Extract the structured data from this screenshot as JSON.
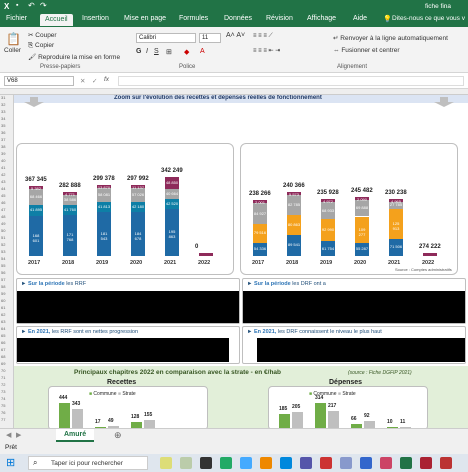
{
  "title_bar": {
    "app_label": "X",
    "doc_name": "fiche fina"
  },
  "tabs": [
    "Fichier",
    "Accueil",
    "Insertion",
    "Mise en page",
    "Formules",
    "Données",
    "Révision",
    "Affichage",
    "Aide"
  ],
  "tell_me": "Dites-nous ce que vous v",
  "clipboard": {
    "paste": "Coller",
    "cut": "Couper",
    "copy": "Copier",
    "format_painter": "Reproduire la mise en forme",
    "group": "Presse-papiers"
  },
  "font": {
    "name": "Calibri",
    "size": "11",
    "group": "Police"
  },
  "alignment": {
    "wrap": "Renvoyer à la ligne automatiquement",
    "merge": "Fusionner et centrer",
    "group": "Alignement"
  },
  "name_box": "V68",
  "fx": "fx",
  "banner": "Zoom sur l'évolution des recettes et dépenses réelles de fonctionnement",
  "rrf_chart": {
    "totals": [
      "367 345",
      "282 888",
      "299 378",
      "297 992",
      "342 249",
      "0"
    ],
    "years": [
      "2017",
      "2018",
      "2019",
      "2020",
      "2021",
      "2022"
    ],
    "bottom": [
      "168 601",
      "171 768",
      "181 543",
      "184 678",
      "195 863"
    ],
    "mid": [
      "41 895",
      "41 760",
      "41 813",
      "42 180",
      "42 520"
    ],
    "upper": [
      "68 466",
      "38 586",
      "58 081",
      "57 026",
      "40 664"
    ],
    "top": [
      "5 382",
      "4 771",
      "13 870",
      "11 137",
      "48 850"
    ]
  },
  "drf_chart": {
    "totals": [
      "238 266",
      "240 366",
      "235 928",
      "245 482",
      "230 238",
      "274 222"
    ],
    "years": [
      "2017",
      "2018",
      "2019",
      "2020",
      "2021",
      "2022"
    ],
    "bottom": [
      "54 336",
      "89 541",
      "61 754",
      "55 287",
      "71 506"
    ],
    "orange": [
      "79 516",
      "80 863",
      "92 990",
      "109 277",
      "125 913"
    ],
    "gray": [
      "84 927",
      "82 785",
      "68 933",
      "69 888",
      "27 785"
    ],
    "top": [
      "2 001",
      "5 573",
      "4 972",
      "2 090",
      "4 965"
    ],
    "source": "Source : Comptes administratifs"
  },
  "sections": {
    "rrf_period_prefix": "Sur la période",
    "rrf_period_suffix": "les RRF",
    "drf_period_prefix": "Sur la période",
    "drf_period_suffix": "les DRF ont a",
    "rrf_2021_prefix": "En 2021,",
    "rrf_2021_suffix": "les RRF sont en nettes progression",
    "drf_2021_prefix": "En 2021,",
    "drf_2021_suffix": "les DRF connaissent le niveau le plus haut"
  },
  "strate": {
    "title": "Principaux chapitres 2022 en comparaison avec la strate - en €/hab",
    "source": "(source : Fiche DGFIP 2021)",
    "recettes": "Recettes",
    "depenses": "Dépenses",
    "commune": "Commune",
    "strate": "Strate",
    "rec_vals": [
      "444",
      "343",
      "17",
      "49",
      "128",
      "155"
    ],
    "dep_vals": [
      "185",
      "205",
      "314",
      "217",
      "66",
      "92",
      "10",
      "11"
    ]
  },
  "sheet_tab": "Amuré",
  "status": "Prêt",
  "search": "Taper ici pour rechercher",
  "colors": {
    "excel_green": "#217346",
    "blue": "#1f6aa5",
    "gray": "#a6a6a6",
    "orange": "#f4a11c",
    "purple": "#8e2a5a",
    "teal": "#0e7fa6",
    "bar_green": "#70ad47"
  }
}
